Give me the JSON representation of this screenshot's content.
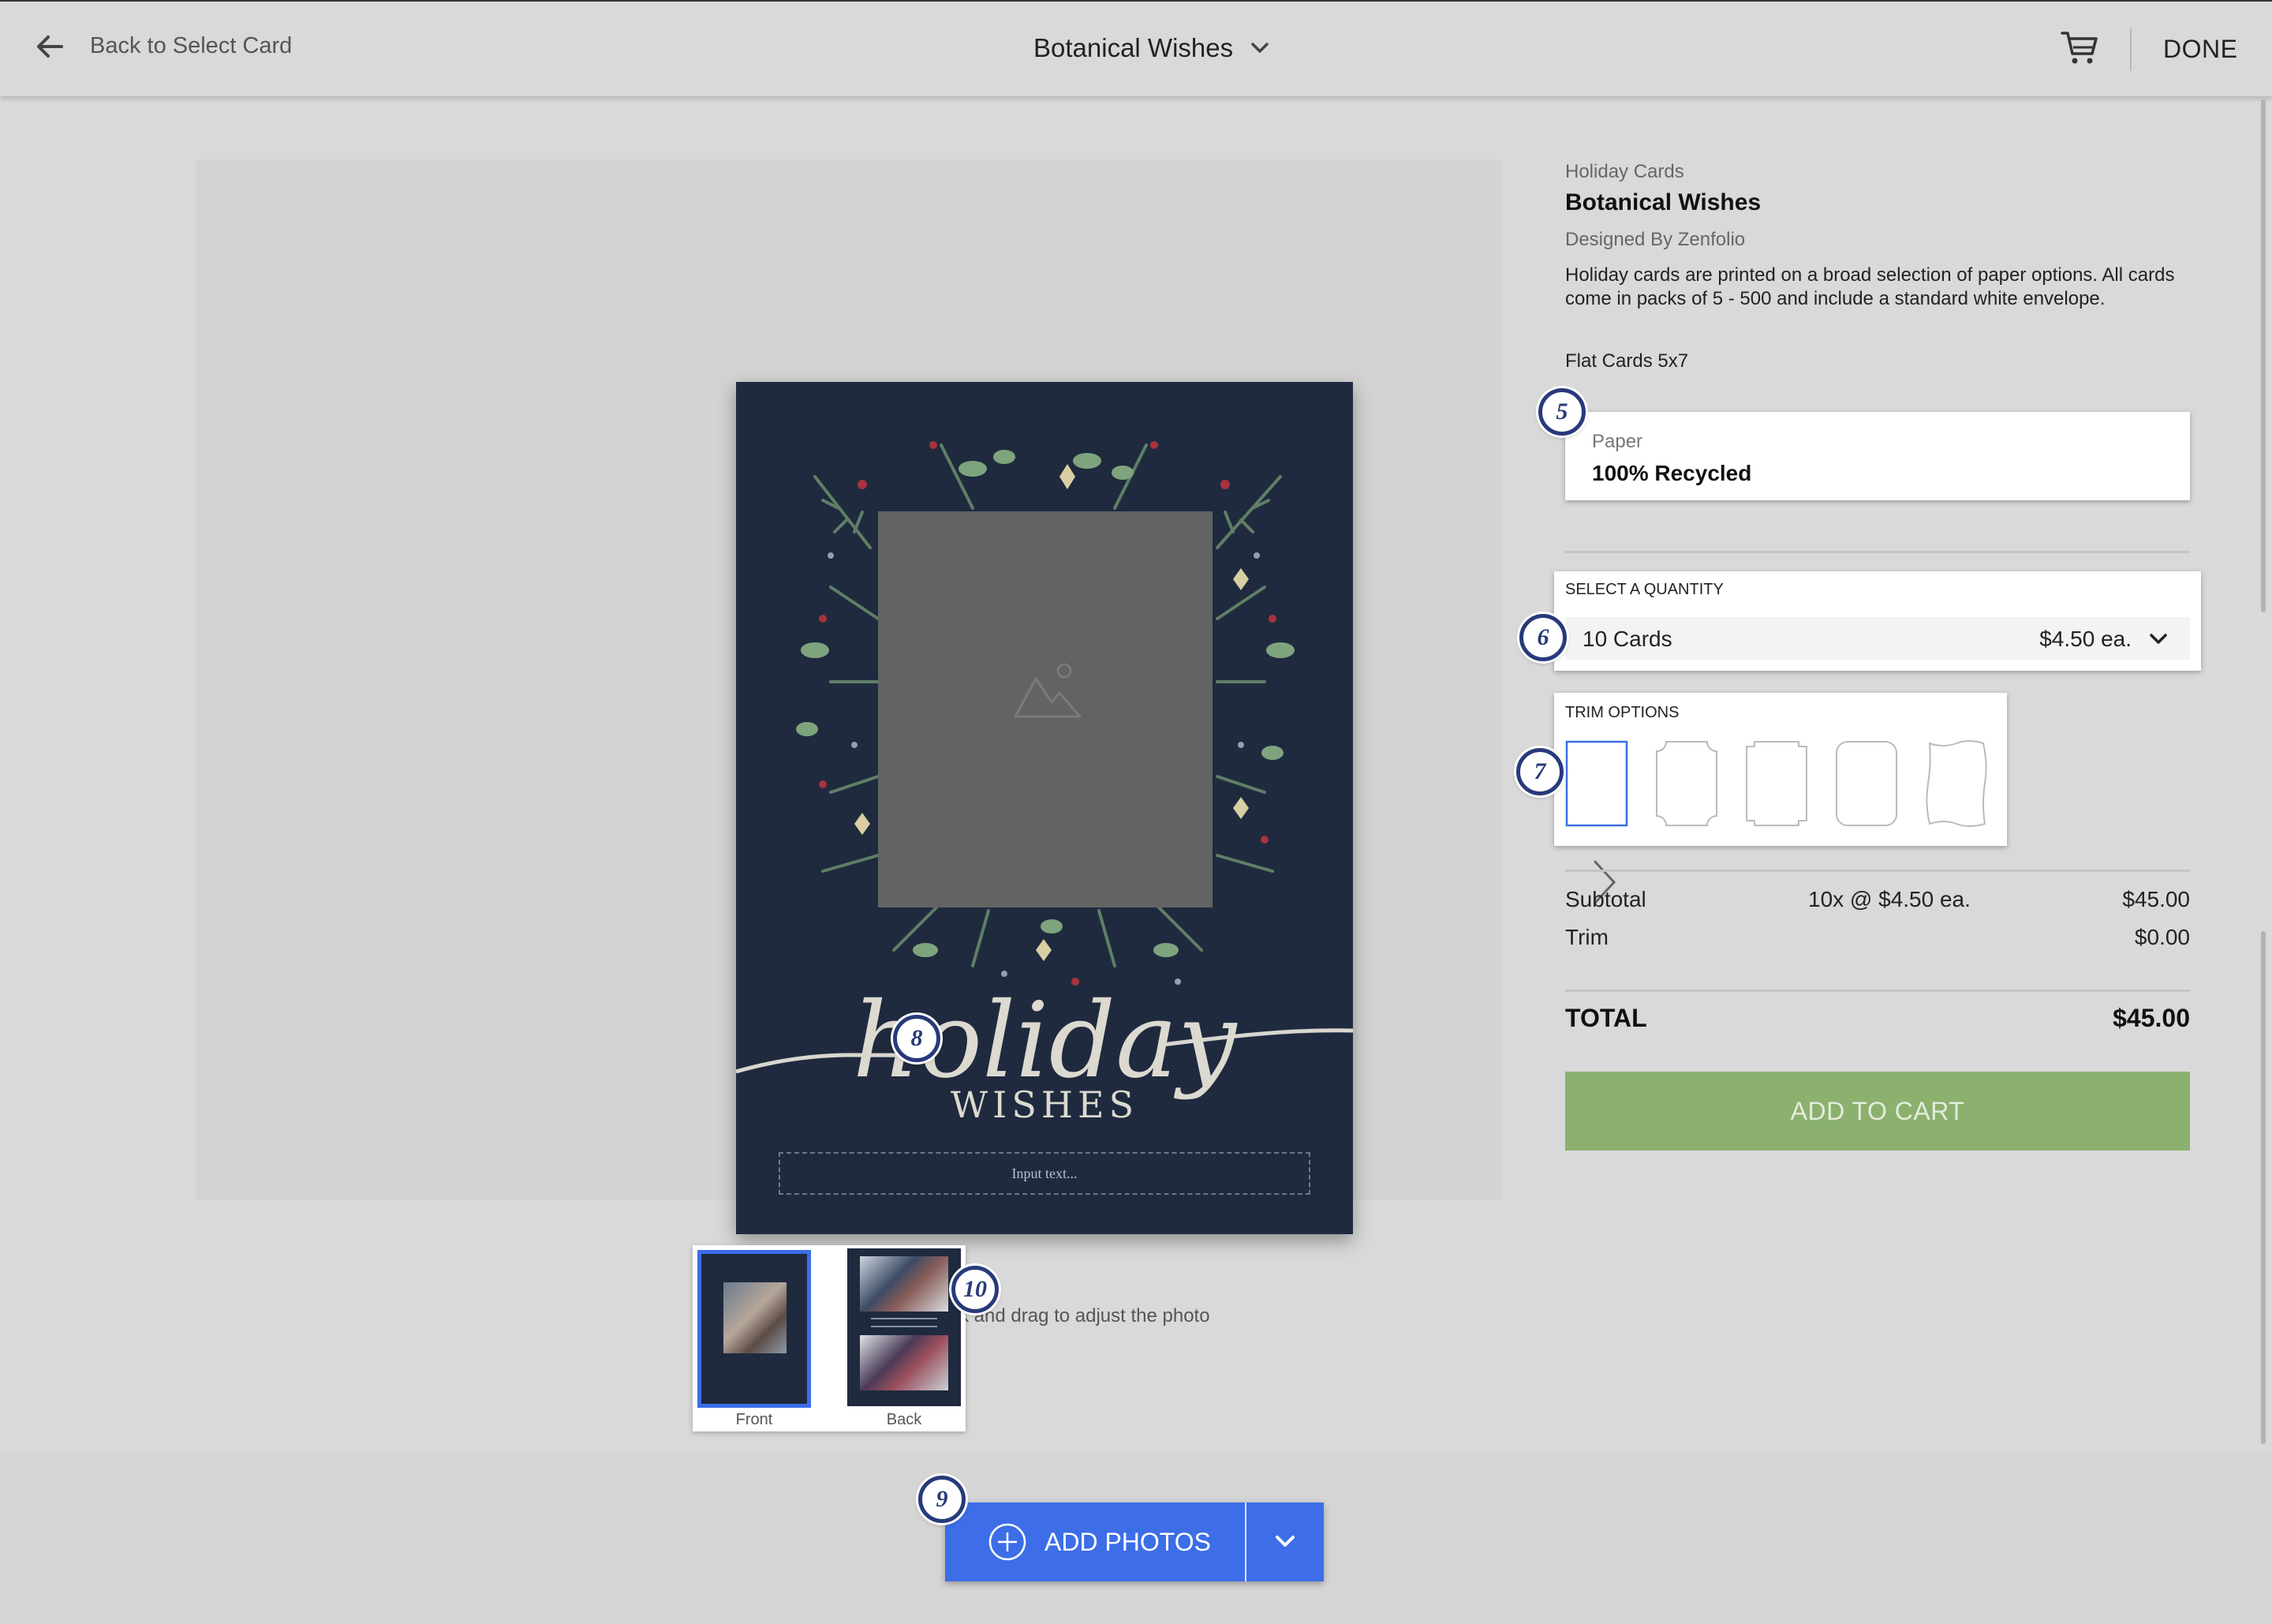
{
  "header": {
    "back_label": "Back to Select Card",
    "title": "Botanical Wishes",
    "done_label": "DONE"
  },
  "preview": {
    "card_input_placeholder": "Input text...",
    "adjust_hint": "Click and drag to adjust the photo",
    "thumbs": [
      {
        "label": "Front"
      },
      {
        "label": "Back"
      }
    ]
  },
  "badges": {
    "b5": "5",
    "b6": "6",
    "b7": "7",
    "b8": "8",
    "b9": "9",
    "b10": "10"
  },
  "product": {
    "category": "Holiday Cards",
    "name": "Botanical Wishes",
    "designer": "Designed By Zenfolio",
    "description": "Holiday cards are printed on a broad selection of paper options. All cards come in packs of 5 - 500 and include a standard white envelope.",
    "size": "Flat Cards 5x7"
  },
  "paper": {
    "label": "Paper",
    "value": "100% Recycled"
  },
  "quantity": {
    "label": "SELECT A QUANTITY",
    "value": "10 Cards",
    "price": "$4.50 ea."
  },
  "trim": {
    "label": "TRIM OPTIONS",
    "selected_index": 0,
    "options": [
      "square",
      "scalloped",
      "notched",
      "rounded",
      "wavy"
    ]
  },
  "summary": {
    "subtotal_label": "Subtotal",
    "subtotal_detail": "10x @ $4.50 ea.",
    "subtotal_value": "$45.00",
    "trim_label": "Trim",
    "trim_value": "$0.00",
    "total_label": "TOTAL",
    "total_value": "$45.00"
  },
  "add_to_cart_label": "ADD TO CART",
  "add_photos_label": "ADD PHOTOS",
  "colors": {
    "accent_blue": "#3d6ee8",
    "add_to_cart_green": "#8cb16e",
    "card_navy": "#1f2a3e",
    "badge_navy": "#283a7a"
  },
  "icons": {
    "back": "arrow-left-icon",
    "title_dropdown": "chevron-down-icon",
    "cart": "cart-icon",
    "next": "chevron-right-icon",
    "move": "move-icon",
    "add": "plus-circle-icon",
    "image_placeholder": "image-placeholder-icon"
  }
}
